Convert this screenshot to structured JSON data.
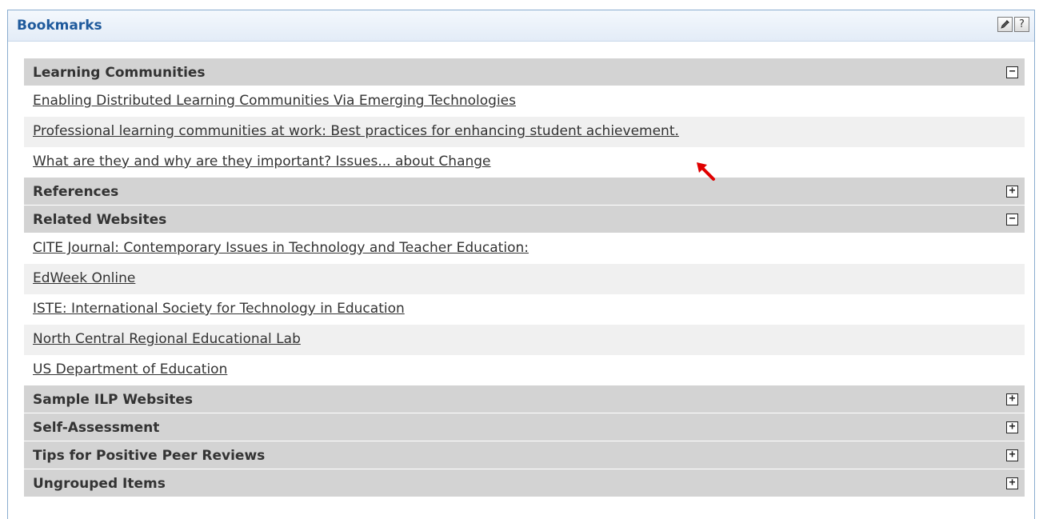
{
  "portlet": {
    "title": "Bookmarks",
    "edit_icon": "edit-icon",
    "help_label": "?"
  },
  "groups": [
    {
      "title": "Learning Communities",
      "state": "expanded",
      "toggle": "−",
      "items": [
        "Enabling Distributed Learning Communities Via Emerging Technologies",
        "Professional learning communities at work: Best practices for enhancing student achievement.",
        "What are they and why are they important? Issues... about Change"
      ]
    },
    {
      "title": "References",
      "state": "collapsed",
      "toggle": "+"
    },
    {
      "title": "Related Websites",
      "state": "expanded",
      "toggle": "−",
      "items": [
        "CITE Journal: Contemporary Issues in Technology and Teacher Education:",
        "EdWeek Online",
        "ISTE: International Society for Technology in Education",
        "North Central Regional Educational Lab",
        "US Department of Education"
      ]
    },
    {
      "title": "Sample ILP Websites",
      "state": "collapsed",
      "toggle": "+"
    },
    {
      "title": "Self-Assessment",
      "state": "collapsed",
      "toggle": "+"
    },
    {
      "title": "Tips for Positive Peer Reviews",
      "state": "collapsed",
      "toggle": "+"
    },
    {
      "title": "Ungrouped Items",
      "state": "collapsed",
      "toggle": "+"
    }
  ],
  "colors": {
    "title": "#1f5a9c",
    "group_header_bg": "#d3d3d3",
    "alt_row_bg": "#f0f0f0",
    "annotation_arrow": "#e00000"
  }
}
